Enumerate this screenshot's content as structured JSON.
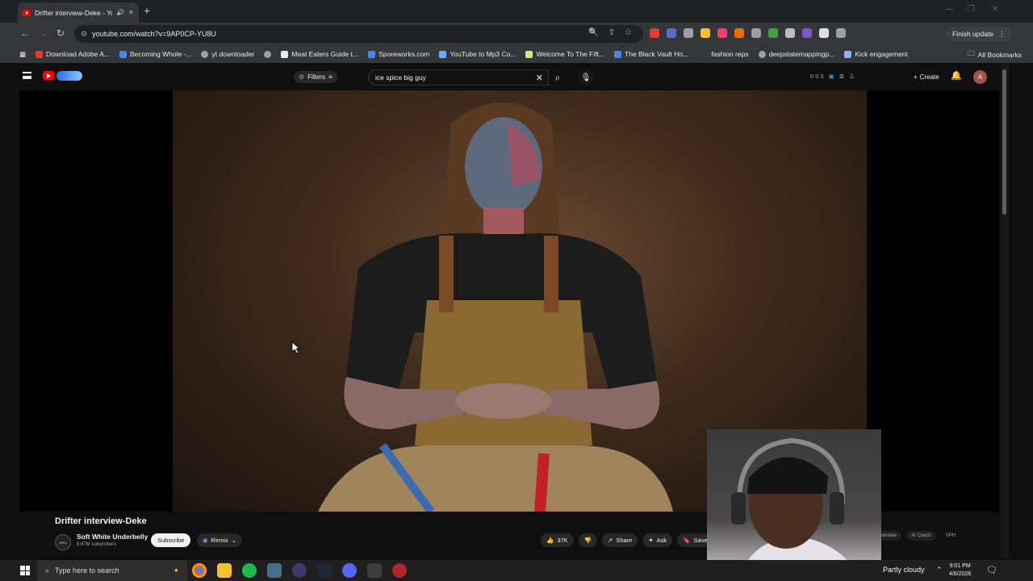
{
  "browser": {
    "tab_title": "Drifter interview-Deke - Yo",
    "url": "youtube.com/watch?v=9AP0CP-YU8U",
    "profile_button": "Finish update"
  },
  "bookmarks": [
    {
      "label": "Download Adobe A...",
      "color": "#e03a2f"
    },
    {
      "label": "Becoming Whole -...",
      "color": "#4a86e8"
    },
    {
      "label": "yt downloader",
      "color": "#9aa0a6"
    },
    {
      "label": "",
      "color": "#9aa0a6"
    },
    {
      "label": "Meat Eaters Guide t...",
      "color": "#e8eaed"
    },
    {
      "label": "Sporeworks.com",
      "color": "#4a86e8"
    },
    {
      "label": "YouTube to Mp3 Co...",
      "color": "#6ea8ff"
    },
    {
      "label": "Welcome To The Fift...",
      "color": "#d7e96b"
    },
    {
      "label": "The Black Vault Ho...",
      "color": "#4a86e8"
    },
    {
      "label": "fashion reps",
      "color": "#35363a"
    },
    {
      "label": "deepstatemappingp...",
      "color": "#9aa0a6"
    },
    {
      "label": "Kick engagement",
      "color": "#8ab4f8"
    }
  ],
  "bookmarks_all": "All Bookmarks",
  "youtube": {
    "filters_label": "Filters",
    "search_value": "ice spice big guy",
    "top_counters": "0  0  0",
    "create_label": "Create",
    "avatar_letter": "A"
  },
  "video": {
    "title": "Drifter interview-Deke",
    "channel": "Soft White Underbelly",
    "subscribers": "6.87M subscribers",
    "subscribe_label": "Subscribe",
    "remix_label": "Remix",
    "likes": "37K",
    "share_label": "Share",
    "ask_label": "Ask",
    "save_label": "Save",
    "side_tab_1": "Overview",
    "side_tab_2": "AI Coach",
    "side_label": "VPH"
  },
  "taskbar": {
    "search_placeholder": "Type here to search",
    "weather": "Partly cloudy",
    "time": "9:01 PM",
    "date": "4/6/2026"
  }
}
